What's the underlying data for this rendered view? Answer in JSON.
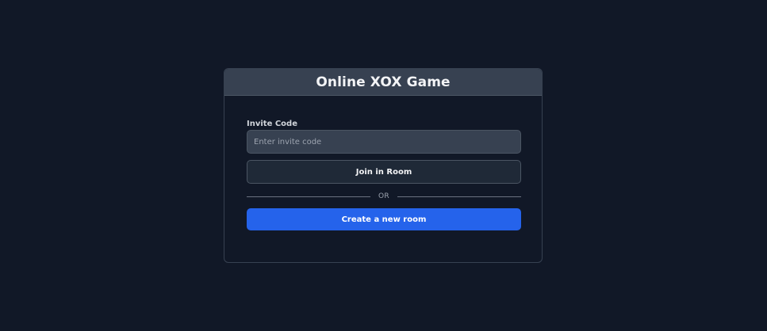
{
  "card": {
    "title": "Online XOX Game",
    "invite": {
      "label": "Invite Code",
      "placeholder": "Enter invite code",
      "value": ""
    },
    "join_button_label": "Join in Room",
    "divider_text": "OR",
    "create_button_label": "Create a new room"
  },
  "colors": {
    "background": "#111827",
    "header_background": "#374151",
    "input_background": "#374151",
    "join_button_background": "#1f2937",
    "accent": "#2563eb"
  }
}
